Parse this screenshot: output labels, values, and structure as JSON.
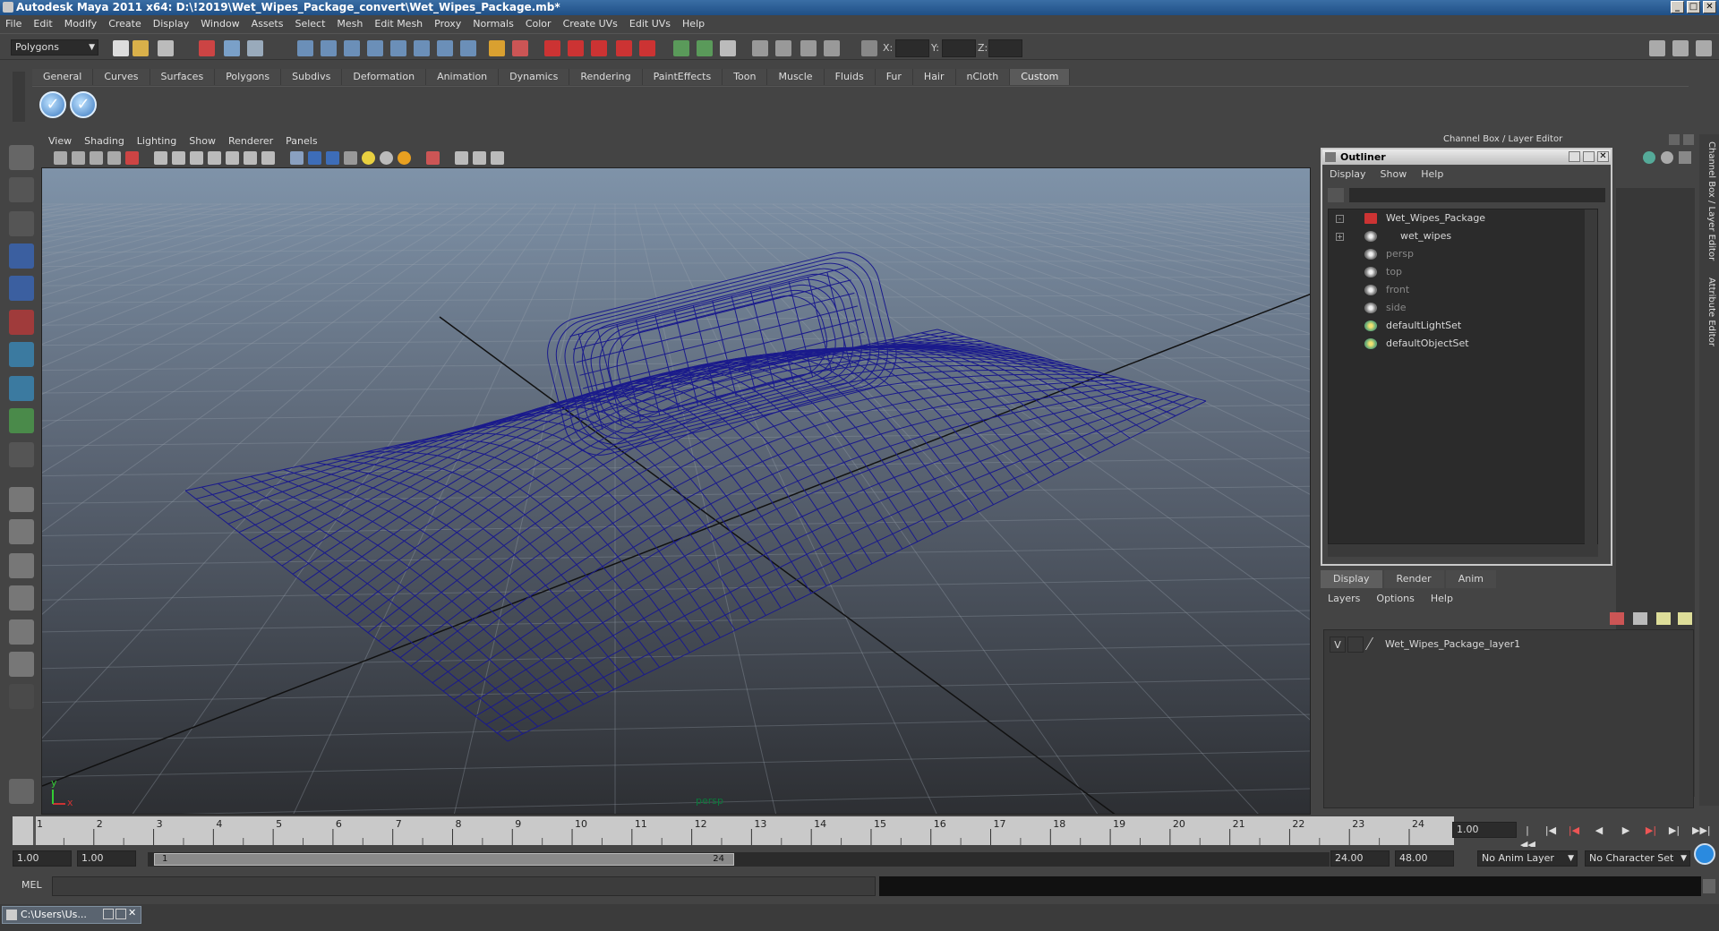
{
  "window": {
    "title": "Autodesk Maya 2011 x64: D:\\!2019\\Wet_Wipes_Package_convert\\Wet_Wipes_Package.mb*"
  },
  "menubar": [
    "File",
    "Edit",
    "Modify",
    "Create",
    "Display",
    "Window",
    "Assets",
    "Select",
    "Mesh",
    "Edit Mesh",
    "Proxy",
    "Normals",
    "Color",
    "Create UVs",
    "Edit UVs",
    "Help"
  ],
  "statusline": {
    "mode": "Polygons",
    "x_label": "X:",
    "y_label": "Y:",
    "z_label": "Z:"
  },
  "shelf": {
    "tabs": [
      "General",
      "Curves",
      "Surfaces",
      "Polygons",
      "Subdivs",
      "Deformation",
      "Animation",
      "Dynamics",
      "Rendering",
      "PaintEffects",
      "Toon",
      "Muscle",
      "Fluids",
      "Fur",
      "Hair",
      "nCloth",
      "Custom"
    ],
    "active_tab": "Custom"
  },
  "viewport": {
    "menu": [
      "View",
      "Shading",
      "Lighting",
      "Show",
      "Renderer",
      "Panels"
    ],
    "camera": "persp",
    "axis_x": "x",
    "axis_y": "y",
    "wire_color": "#1a1a8c"
  },
  "outliner": {
    "title": "Outliner",
    "menu": [
      "Display",
      "Show",
      "Help"
    ],
    "items": [
      {
        "label": "Wet_Wipes_Package",
        "expander": "-",
        "dim": false
      },
      {
        "label": "wet_wipes",
        "expander": "+",
        "dim": false
      },
      {
        "label": "persp",
        "expander": "",
        "dim": true
      },
      {
        "label": "top",
        "expander": "",
        "dim": true
      },
      {
        "label": "front",
        "expander": "",
        "dim": true
      },
      {
        "label": "side",
        "expander": "",
        "dim": true
      },
      {
        "label": "defaultLightSet",
        "expander": "",
        "dim": false
      },
      {
        "label": "defaultObjectSet",
        "expander": "",
        "dim": false
      }
    ]
  },
  "channel_box": {
    "header": "Channel Box / Layer Editor"
  },
  "side_tabs": [
    "Channel Box / Layer Editor",
    "Attribute Editor"
  ],
  "layer_editor": {
    "tabs": [
      "Display",
      "Render",
      "Anim"
    ],
    "active_tab": "Display",
    "menu": [
      "Layers",
      "Options",
      "Help"
    ],
    "layers": [
      {
        "visible": "V",
        "name": "Wet_Wipes_Package_layer1"
      }
    ]
  },
  "time_slider": {
    "frames": [
      "1",
      "2",
      "3",
      "4",
      "5",
      "6",
      "7",
      "8",
      "9",
      "10",
      "11",
      "12",
      "13",
      "14",
      "15",
      "16",
      "17",
      "18",
      "19",
      "20",
      "21",
      "22",
      "23",
      "24"
    ],
    "current_frame": "1.00"
  },
  "range_slider": {
    "start": "1.00",
    "playback_start": "1.00",
    "handle_start": "1",
    "handle_end": "24",
    "playback_end": "24.00",
    "end": "48.00",
    "anim_layer": "No Anim Layer",
    "character_set": "No Character Set"
  },
  "command_line": {
    "label": "MEL"
  },
  "taskbar": {
    "item": "C:\\Users\\Us..."
  }
}
